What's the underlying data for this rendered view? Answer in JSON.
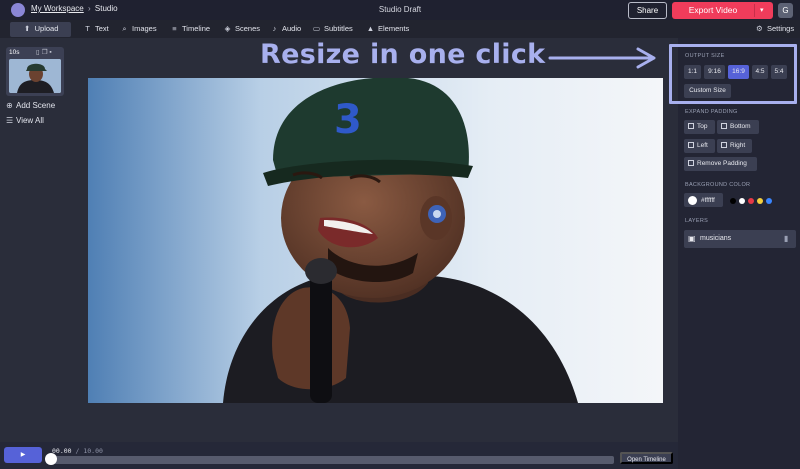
{
  "header": {
    "workspace": "My Workspace",
    "separator": "›",
    "section": "Studio",
    "project_title": "Studio Draft",
    "share_label": "Share",
    "export_label": "Export Video",
    "export_caret": "▾",
    "user_initial": "G"
  },
  "toolbar": {
    "upload": "Upload",
    "text": "Text",
    "images": "Images",
    "timeline": "Timeline",
    "scenes": "Scenes",
    "audio": "Audio",
    "subtitles": "Subtitles",
    "elements": "Elements",
    "settings": "Settings"
  },
  "scenes": {
    "duration": "10s",
    "add_scene": "Add Scene",
    "view_all": "View All"
  },
  "annotation": {
    "text": "Resize in one click"
  },
  "right_panel": {
    "output_size": {
      "heading": "OUTPUT SIZE",
      "options": [
        "1:1",
        "9:16",
        "16:9",
        "4:5",
        "5:4"
      ],
      "selected": "16:9",
      "custom": "Custom Size"
    },
    "expand_padding": {
      "heading": "EXPAND PADDING",
      "top": "Top",
      "bottom": "Bottom",
      "left": "Left",
      "right": "Right",
      "remove": "Remove Padding"
    },
    "background_color": {
      "heading": "BACKGROUND COLOR",
      "hex": "#ffffff",
      "swatches": [
        "#000000",
        "#ffffff",
        "#e63946",
        "#f4d03f",
        "#3a86ff"
      ]
    },
    "layers": {
      "heading": "LAYERS",
      "items": [
        "musicians"
      ]
    }
  },
  "playback": {
    "play_icon": "▶",
    "current": "00.00",
    "separator": " / ",
    "total": "10.00",
    "progress": 0,
    "open_timeline": "Open Timeline"
  },
  "colors": {
    "accent": "#5662d8",
    "export": "#f03c5b",
    "annotation": "#a8b0ee"
  }
}
